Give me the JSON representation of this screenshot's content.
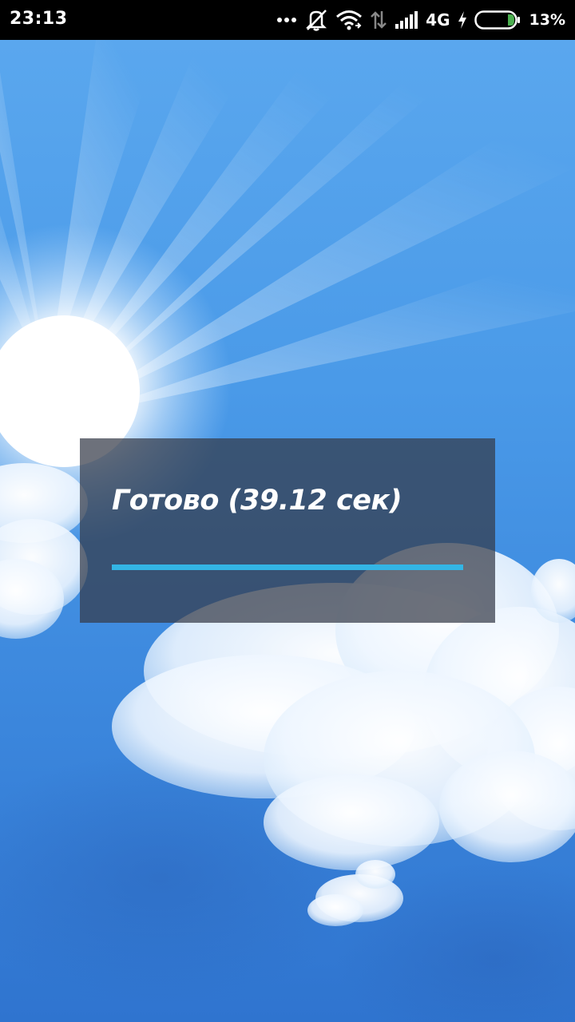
{
  "status_bar": {
    "time": "23:13",
    "network_type": "4G",
    "battery_percent": "13%",
    "battery_level": 0.13,
    "charging": true,
    "icons": [
      "more-dots-icon",
      "vibrate-off-icon",
      "wifi-icon",
      "data-arrows-icon",
      "signal-icon",
      "charging-bolt-icon",
      "battery-icon"
    ],
    "battery_accent_color": "#4caf50"
  },
  "dialog": {
    "title": "Готово (39.12 сек)",
    "progress": 1.0,
    "progress_color": "#33b5e5"
  }
}
